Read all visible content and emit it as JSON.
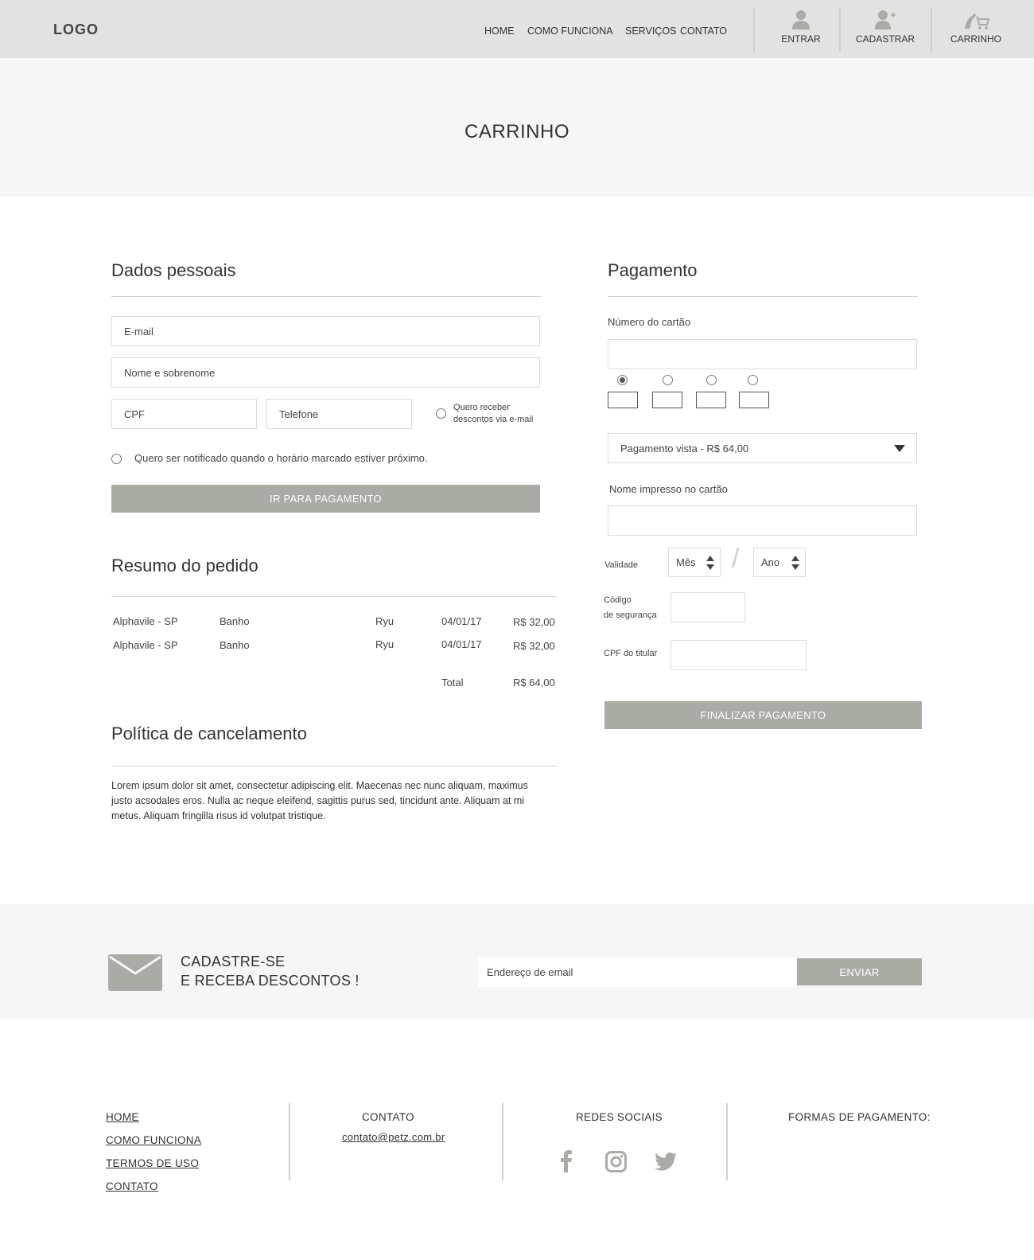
{
  "header": {
    "logo": "LOGO",
    "nav": [
      "HOME",
      "COMO FUNCIONA",
      "SERVIÇOS",
      "CONTATO"
    ],
    "entrar": "ENTRAR",
    "cadastrar": "CADASTRAR",
    "carrinho": "CARRINHO"
  },
  "banner": {
    "title": "CARRINHO"
  },
  "dados": {
    "title": "Dados pessoais",
    "email_placeholder": "E-mail",
    "nome_placeholder": "Nome e sobrenome",
    "cpf_placeholder": "CPF",
    "telefone_placeholder": "Telefone",
    "descontos_line1": "Quero receber",
    "descontos_line2": "descontos via e-mail",
    "notificar": "Quero ser notificado quando o horário marcado estiver próximo.",
    "ir_pagamento": "IR PARA PAGAMENTO"
  },
  "resumo": {
    "title": "Resumo do pedido",
    "rows": [
      {
        "local": "Alphavile - SP",
        "servico": "Banho",
        "pet": "Ryu",
        "data": "04/01/17",
        "valor": "R$ 32,00"
      },
      {
        "local": "Alphavile - SP",
        "servico": "Banho",
        "pet": "Ryu",
        "data": "04/01/17",
        "valor": "R$ 32,00"
      }
    ],
    "total_label": "Total",
    "total_value": "R$ 64,00"
  },
  "politica": {
    "title": "Política de cancelamento",
    "text": "Lorem ipsum dolor sit amet, consectetur adipiscing elit. Maecenas nec nunc aliquam, maximus justo acsodales eros. Nulla ac neque eleifend, sagittis purus sed, tincidunt ante. Aliquam at mi metus. Aliquam fringilla risus id volutpat tristique."
  },
  "pagamento": {
    "title": "Pagamento",
    "numero_label": "Número do cartão",
    "parcelamento": "Pagamento vista - R$ 64,00",
    "nome_label": "Nome impresso no cartão",
    "validade_label": "Validade",
    "mes": "Mês",
    "slash": "/",
    "ano": "Ano",
    "codigo_line1": "Código",
    "codigo_line2": "de segurança",
    "cpf_label": "CPF do titular",
    "finalizar": "FINALIZAR PAGAMENTO"
  },
  "newsletter": {
    "line1": "CADASTRE-SE",
    "line2": "E RECEBA DESCONTOS !",
    "email_placeholder": "Endereço de email",
    "enviar": "ENVIAR"
  },
  "footer": {
    "links": [
      "HOME",
      "COMO FUNCIONA",
      "TERMOS DE USO",
      "CONTATO"
    ],
    "contato_title": "CONTATO",
    "contato_email": "contato@petz.com.br",
    "redes_title": "REDES SOCIAIS",
    "formas_title": "FORMAS DE PAGAMENTO:"
  },
  "colors": {
    "header_bg": "#e2e2e2",
    "banner_bg": "#f6f6f6",
    "button_gray": "#a9aba5",
    "icon_gray": "#a9aba5"
  }
}
